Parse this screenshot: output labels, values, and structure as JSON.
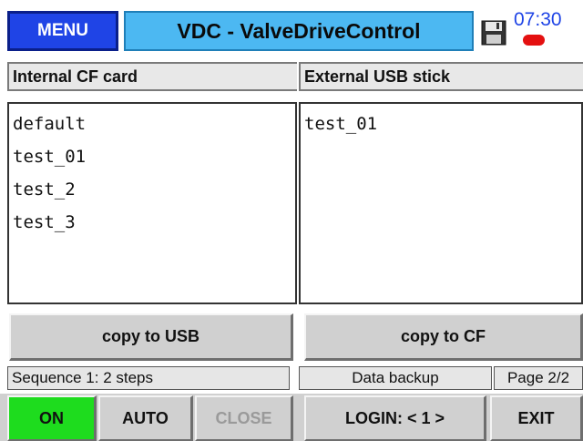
{
  "header": {
    "menu_label": "MENU",
    "title": "VDC - ValveDriveControl",
    "clock": "07:30",
    "save_icon": "floppy-disk-icon",
    "status_color": "#e41010"
  },
  "left_panel": {
    "title": "Internal CF card",
    "files": [
      "default",
      "test_01",
      "test_2",
      "test_3"
    ],
    "button_label": "copy to USB"
  },
  "right_panel": {
    "title": "External USB stick",
    "files": [
      "test_01"
    ],
    "button_label": "copy to CF"
  },
  "status": {
    "sequence": "Sequence 1: 2 steps",
    "mode": "Data backup",
    "page": "Page 2/2"
  },
  "bottom": {
    "on_label": "ON",
    "auto_label": "AUTO",
    "close_label": "CLOSE",
    "login_label": "LOGIN: < 1 >",
    "exit_label": "EXIT",
    "on_color": "#1edc1e"
  }
}
